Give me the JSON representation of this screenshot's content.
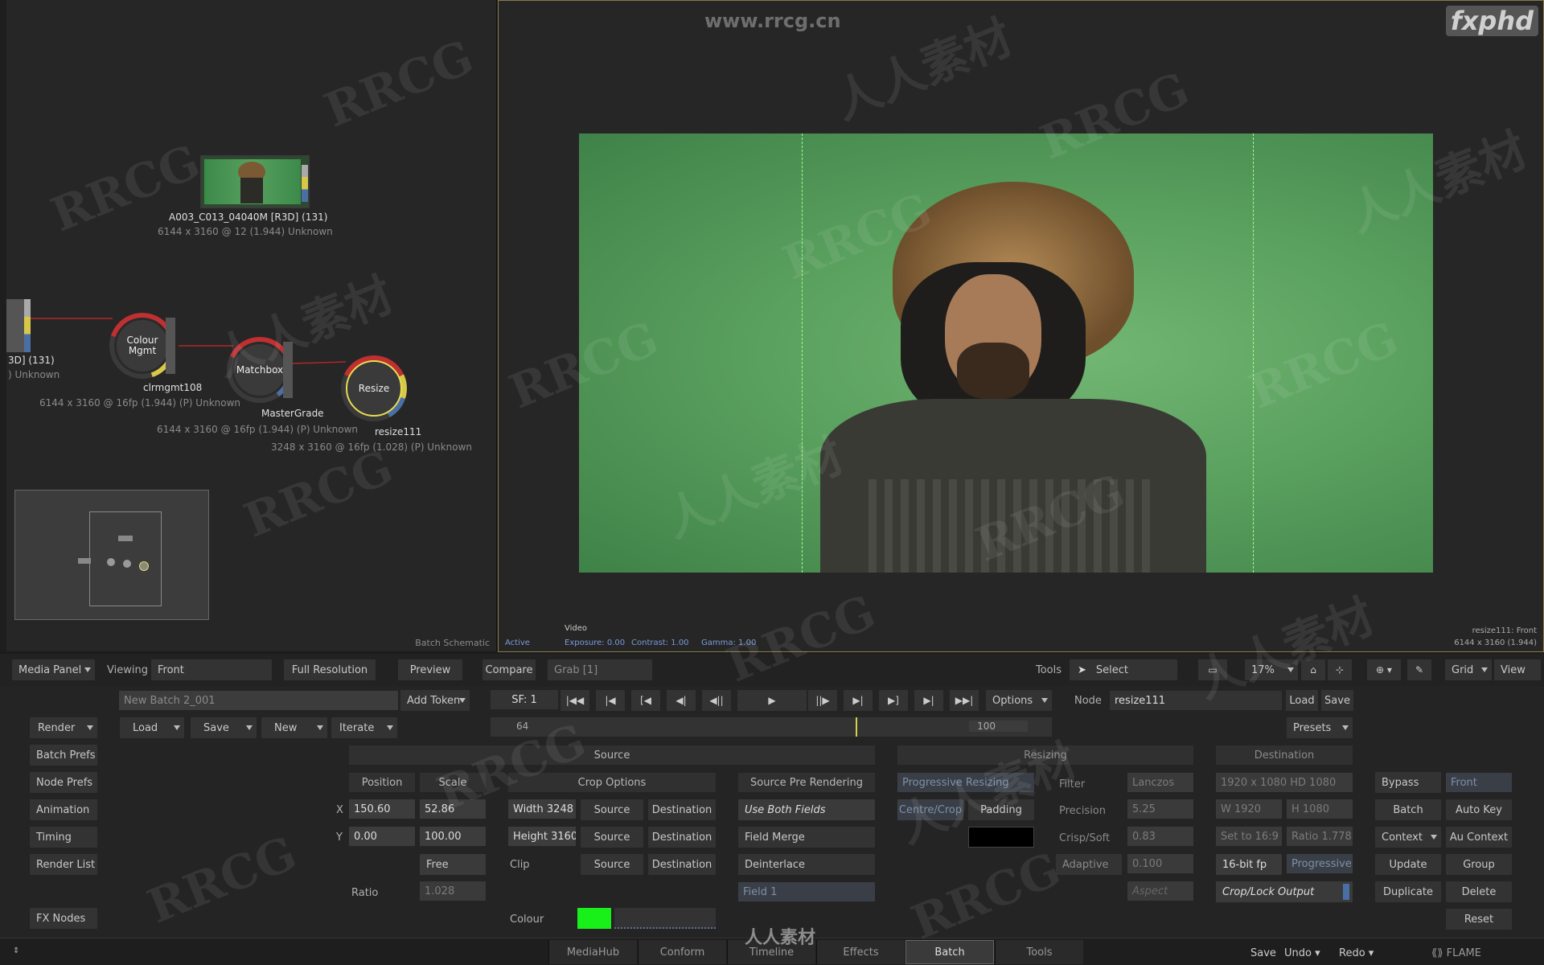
{
  "watermarks": {
    "site": "www.rrcg.cn",
    "logo": "fxphd",
    "rrcg": "RRCG",
    "cn": "人人素材",
    "bottom": "人人素材"
  },
  "schematic": {
    "clip_name": "A003_C013_04040M [R3D] (131)",
    "clip_info": "6144 x 3160 @ 12 (1.944)  Unknown",
    "left_name": "3D] (131)",
    "left_info": ") Unknown",
    "node1_label": "Colour\nMgmt",
    "node1_name": "clrmgmt108",
    "node1_info": "6144 x 3160 @ 16fp (1.944) (P) Unknown",
    "node2_label": "Matchbox",
    "node2_name": "MasterGrade",
    "node2_info": "6144 x 3160 @ 16fp (1.944) (P) Unknown",
    "node3_label": "Resize",
    "node3_name": "resize111",
    "node3_info": "3248 x 3160 @ 16fp (1.028) (P) Unknown",
    "footer": "Batch Schematic"
  },
  "viewer": {
    "mode": "Video",
    "active": "Active",
    "exposure": "Exposure: 0.00",
    "contrast": "Contrast: 1.00",
    "gamma": "Gamma: 1.00",
    "node_info": "resize111: Front",
    "res_info": "6144 x 3160 (1.944)"
  },
  "toolbar": {
    "media_panel": "Media Panel",
    "viewing_label": "Viewing",
    "viewing_value": "Front",
    "full_res": "Full Resolution",
    "preview": "Preview",
    "compare": "Compare",
    "grab": "Grab [1]",
    "tools_label": "Tools",
    "select": "Select",
    "zoom": "17%",
    "grid": "Grid",
    "view": "View"
  },
  "batch": {
    "name": "New Batch 2_001",
    "add_token": "Add Token",
    "render": "Render",
    "load": "Load",
    "save": "Save",
    "new": "New",
    "iterate": "Iterate",
    "side": [
      "Batch Prefs",
      "Node Prefs",
      "Animation",
      "Timing",
      "Render List"
    ],
    "fx_nodes": "FX Nodes"
  },
  "player": {
    "sf": "SF: 1",
    "options": "Options",
    "frame_start": "64",
    "frame_end": "100",
    "playhead": 0.65
  },
  "node_bar": {
    "label": "Node",
    "value": "resize111",
    "load": "Load",
    "save": "Save",
    "presets": "Presets"
  },
  "source": {
    "title": "Source",
    "position": "Position",
    "scale": "Scale",
    "x_label": "X",
    "x_pos": "150.60",
    "x_scale": "52.86",
    "y_label": "Y",
    "y_pos": "0.00",
    "y_scale": "100.00",
    "free": "Free",
    "ratio_label": "Ratio",
    "ratio": "1.028",
    "crop_options": "Crop Options",
    "width": "Width 3248",
    "height": "Height 3160",
    "clip": "Clip",
    "src": "Source",
    "dest": "Destination",
    "colour": "Colour",
    "pre_render": "Source Pre Rendering",
    "use_both": "Use Both Fields",
    "field_merge": "Field Merge",
    "deinterlace": "Deinterlace",
    "field1": "Field 1"
  },
  "resizing": {
    "title": "Resizing",
    "progressive": "Progressive Resizing",
    "centre_crop": "Centre/Crop",
    "padding": "Padding",
    "filter_label": "Filter",
    "filter": "Lanczos",
    "precision_label": "Precision",
    "precision": "5.25",
    "crisp_label": "Crisp/Soft",
    "crisp": "0.83",
    "adaptive": "Adaptive",
    "adaptive_val": "0.100",
    "aspect": "Aspect"
  },
  "destination": {
    "title": "Destination",
    "format": "1920 x 1080 HD 1080",
    "w": "W 1920",
    "h": "H 1080",
    "set169": "Set to 16:9",
    "ratio": "Ratio 1.778",
    "bitdepth": "16-bit fp",
    "scan": "Progressive",
    "crop_lock": "Crop/Lock Output"
  },
  "right": {
    "bypass": "Bypass",
    "front": "Front",
    "batch": "Batch",
    "auto_key": "Auto Key",
    "context": "Context",
    "au_context": "Au Context",
    "update": "Update",
    "group": "Group",
    "duplicate": "Duplicate",
    "delete": "Delete",
    "reset": "Reset"
  },
  "tabs": [
    "MediaHub",
    "Conform",
    "Timeline",
    "Effects",
    "Batch",
    "Tools"
  ],
  "status": {
    "save": "Save",
    "undo": "Undo",
    "redo": "Redo",
    "app": "FLAME"
  },
  "colors": {
    "accent": "#4a6fa5",
    "node_ring": "#d8d04a",
    "colour_swatch": "#19f019"
  }
}
